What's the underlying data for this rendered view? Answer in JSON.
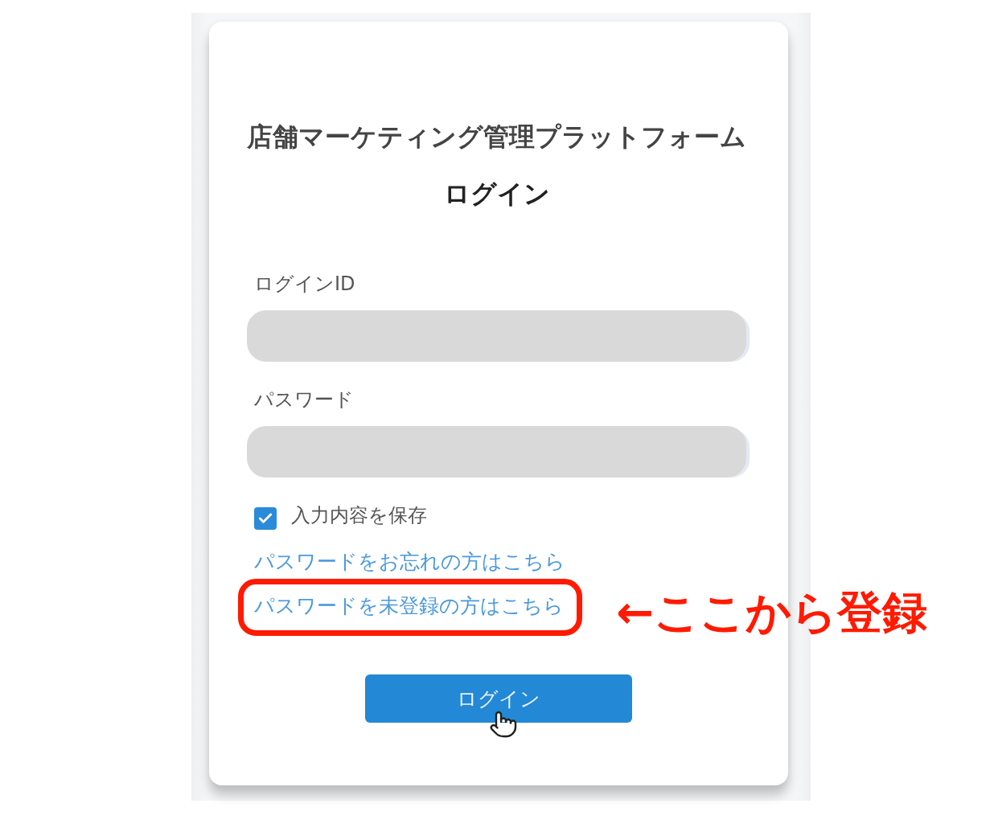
{
  "page": {
    "title": "店舗マーケティング管理プラットフォーム",
    "heading": "ログイン"
  },
  "fields": [
    {
      "label": "ログインID",
      "redacted": true
    },
    {
      "label": "パスワード",
      "redacted": true
    }
  ],
  "remember": {
    "label": "入力内容を保存",
    "checked": true
  },
  "links": [
    {
      "text": "パスワードをお忘れの方はこちら",
      "highlighted": false
    },
    {
      "text": "パスワードを未登録の方はこちら",
      "highlighted": true
    }
  ],
  "login_button": {
    "label": "ログイン"
  },
  "annotation": {
    "text": "←ここから登録"
  }
}
